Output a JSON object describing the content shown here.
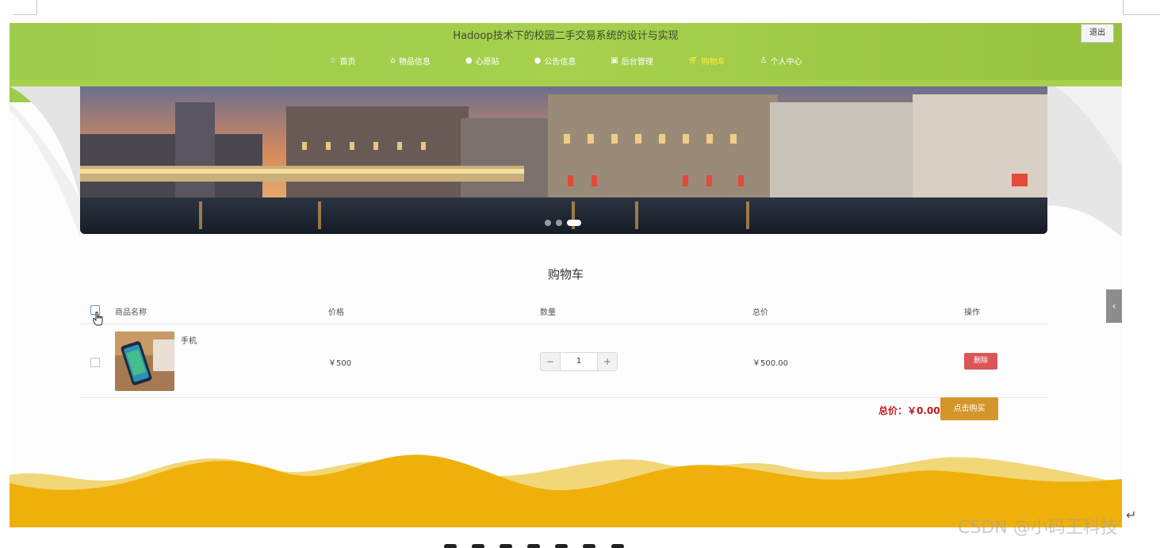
{
  "header": {
    "site_title": "Hadoop技术下的校园二手交易系统的设计与实现",
    "logout_label": "退出",
    "nav": [
      {
        "label": "首页",
        "icon": "star-icon",
        "active": false
      },
      {
        "label": "物品信息",
        "icon": "bag-icon",
        "active": false
      },
      {
        "label": "心愿贴",
        "icon": "heart-icon",
        "active": false
      },
      {
        "label": "公告信息",
        "icon": "info-icon",
        "active": false
      },
      {
        "label": "后台管理",
        "icon": "admin-icon",
        "active": false
      },
      {
        "label": "购物车",
        "icon": "cart-icon",
        "active": true
      },
      {
        "label": "个人中心",
        "icon": "user-icon",
        "active": false
      }
    ]
  },
  "banner": {
    "slide_count": 3,
    "active_slide": 3
  },
  "cart": {
    "title": "购物车",
    "columns": [
      "商品名称",
      "价格",
      "数量",
      "总价",
      "操作"
    ],
    "rows": [
      {
        "name": "手机",
        "price": "￥500",
        "quantity": "1",
        "total": "￥500.00",
        "action_label": "删除",
        "checked": false
      }
    ],
    "summary_label": "总价：",
    "summary_value": "￥0.00",
    "buy_label": "点击购买"
  },
  "colors": {
    "header_green": "#a6d04e",
    "active_nav": "#ffef3a",
    "delete_red": "#db5656",
    "buy_orange": "#d4952a",
    "price_red": "#c8181e",
    "footer_yellow": "#f0b300"
  },
  "watermark": "CSDN @小码王科技"
}
